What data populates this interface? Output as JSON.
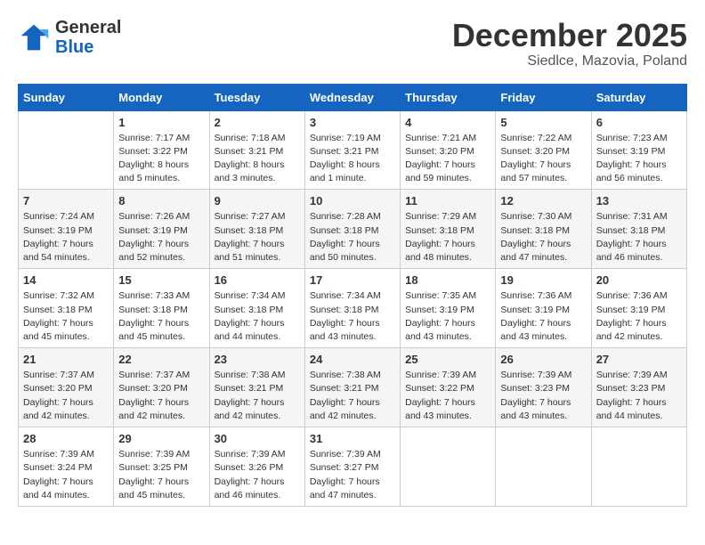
{
  "logo": {
    "general": "General",
    "blue": "Blue"
  },
  "title": "December 2025",
  "location": "Siedlce, Mazovia, Poland",
  "days_header": [
    "Sunday",
    "Monday",
    "Tuesday",
    "Wednesday",
    "Thursday",
    "Friday",
    "Saturday"
  ],
  "weeks": [
    [
      {
        "day": "",
        "content": ""
      },
      {
        "day": "1",
        "content": "Sunrise: 7:17 AM\nSunset: 3:22 PM\nDaylight: 8 hours\nand 5 minutes."
      },
      {
        "day": "2",
        "content": "Sunrise: 7:18 AM\nSunset: 3:21 PM\nDaylight: 8 hours\nand 3 minutes."
      },
      {
        "day": "3",
        "content": "Sunrise: 7:19 AM\nSunset: 3:21 PM\nDaylight: 8 hours\nand 1 minute."
      },
      {
        "day": "4",
        "content": "Sunrise: 7:21 AM\nSunset: 3:20 PM\nDaylight: 7 hours\nand 59 minutes."
      },
      {
        "day": "5",
        "content": "Sunrise: 7:22 AM\nSunset: 3:20 PM\nDaylight: 7 hours\nand 57 minutes."
      },
      {
        "day": "6",
        "content": "Sunrise: 7:23 AM\nSunset: 3:19 PM\nDaylight: 7 hours\nand 56 minutes."
      }
    ],
    [
      {
        "day": "7",
        "content": "Sunrise: 7:24 AM\nSunset: 3:19 PM\nDaylight: 7 hours\nand 54 minutes."
      },
      {
        "day": "8",
        "content": "Sunrise: 7:26 AM\nSunset: 3:19 PM\nDaylight: 7 hours\nand 52 minutes."
      },
      {
        "day": "9",
        "content": "Sunrise: 7:27 AM\nSunset: 3:18 PM\nDaylight: 7 hours\nand 51 minutes."
      },
      {
        "day": "10",
        "content": "Sunrise: 7:28 AM\nSunset: 3:18 PM\nDaylight: 7 hours\nand 50 minutes."
      },
      {
        "day": "11",
        "content": "Sunrise: 7:29 AM\nSunset: 3:18 PM\nDaylight: 7 hours\nand 48 minutes."
      },
      {
        "day": "12",
        "content": "Sunrise: 7:30 AM\nSunset: 3:18 PM\nDaylight: 7 hours\nand 47 minutes."
      },
      {
        "day": "13",
        "content": "Sunrise: 7:31 AM\nSunset: 3:18 PM\nDaylight: 7 hours\nand 46 minutes."
      }
    ],
    [
      {
        "day": "14",
        "content": "Sunrise: 7:32 AM\nSunset: 3:18 PM\nDaylight: 7 hours\nand 45 minutes."
      },
      {
        "day": "15",
        "content": "Sunrise: 7:33 AM\nSunset: 3:18 PM\nDaylight: 7 hours\nand 45 minutes."
      },
      {
        "day": "16",
        "content": "Sunrise: 7:34 AM\nSunset: 3:18 PM\nDaylight: 7 hours\nand 44 minutes."
      },
      {
        "day": "17",
        "content": "Sunrise: 7:34 AM\nSunset: 3:18 PM\nDaylight: 7 hours\nand 43 minutes."
      },
      {
        "day": "18",
        "content": "Sunrise: 7:35 AM\nSunset: 3:19 PM\nDaylight: 7 hours\nand 43 minutes."
      },
      {
        "day": "19",
        "content": "Sunrise: 7:36 AM\nSunset: 3:19 PM\nDaylight: 7 hours\nand 43 minutes."
      },
      {
        "day": "20",
        "content": "Sunrise: 7:36 AM\nSunset: 3:19 PM\nDaylight: 7 hours\nand 42 minutes."
      }
    ],
    [
      {
        "day": "21",
        "content": "Sunrise: 7:37 AM\nSunset: 3:20 PM\nDaylight: 7 hours\nand 42 minutes."
      },
      {
        "day": "22",
        "content": "Sunrise: 7:37 AM\nSunset: 3:20 PM\nDaylight: 7 hours\nand 42 minutes."
      },
      {
        "day": "23",
        "content": "Sunrise: 7:38 AM\nSunset: 3:21 PM\nDaylight: 7 hours\nand 42 minutes."
      },
      {
        "day": "24",
        "content": "Sunrise: 7:38 AM\nSunset: 3:21 PM\nDaylight: 7 hours\nand 42 minutes."
      },
      {
        "day": "25",
        "content": "Sunrise: 7:39 AM\nSunset: 3:22 PM\nDaylight: 7 hours\nand 43 minutes."
      },
      {
        "day": "26",
        "content": "Sunrise: 7:39 AM\nSunset: 3:23 PM\nDaylight: 7 hours\nand 43 minutes."
      },
      {
        "day": "27",
        "content": "Sunrise: 7:39 AM\nSunset: 3:23 PM\nDaylight: 7 hours\nand 44 minutes."
      }
    ],
    [
      {
        "day": "28",
        "content": "Sunrise: 7:39 AM\nSunset: 3:24 PM\nDaylight: 7 hours\nand 44 minutes."
      },
      {
        "day": "29",
        "content": "Sunrise: 7:39 AM\nSunset: 3:25 PM\nDaylight: 7 hours\nand 45 minutes."
      },
      {
        "day": "30",
        "content": "Sunrise: 7:39 AM\nSunset: 3:26 PM\nDaylight: 7 hours\nand 46 minutes."
      },
      {
        "day": "31",
        "content": "Sunrise: 7:39 AM\nSunset: 3:27 PM\nDaylight: 7 hours\nand 47 minutes."
      },
      {
        "day": "",
        "content": ""
      },
      {
        "day": "",
        "content": ""
      },
      {
        "day": "",
        "content": ""
      }
    ]
  ]
}
